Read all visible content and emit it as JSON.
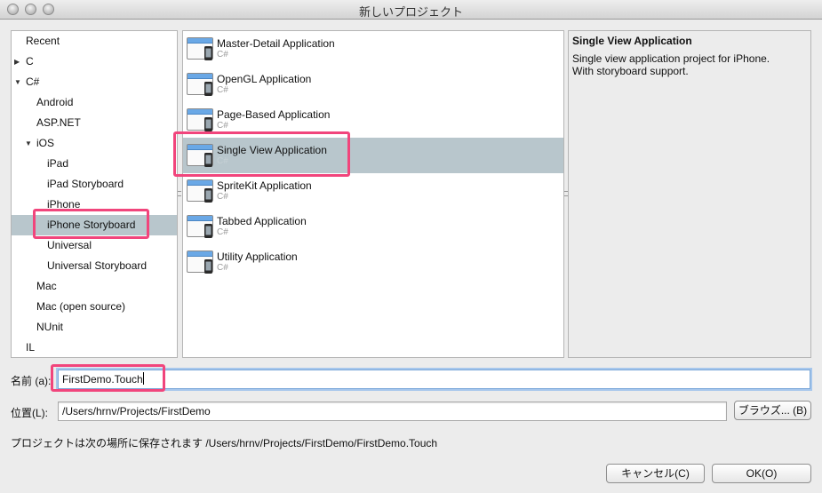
{
  "window": {
    "title": "新しいプロジェクト"
  },
  "categories": [
    {
      "label": "Recent",
      "indent": 0,
      "toggle": "none",
      "selected": false
    },
    {
      "label": "C",
      "indent": 0,
      "toggle": "collapsed",
      "selected": false
    },
    {
      "label": "C#",
      "indent": 0,
      "toggle": "expanded",
      "selected": false
    },
    {
      "label": "Android",
      "indent": 1,
      "toggle": "none",
      "selected": false
    },
    {
      "label": "ASP.NET",
      "indent": 1,
      "toggle": "none",
      "selected": false
    },
    {
      "label": "iOS",
      "indent": 1,
      "toggle": "expanded",
      "selected": false
    },
    {
      "label": "iPad",
      "indent": 2,
      "toggle": "none",
      "selected": false
    },
    {
      "label": "iPad Storyboard",
      "indent": 2,
      "toggle": "none",
      "selected": false
    },
    {
      "label": "iPhone",
      "indent": 2,
      "toggle": "none",
      "selected": false
    },
    {
      "label": "iPhone Storyboard",
      "indent": 2,
      "toggle": "none",
      "selected": true
    },
    {
      "label": "Universal",
      "indent": 2,
      "toggle": "none",
      "selected": false
    },
    {
      "label": "Universal Storyboard",
      "indent": 2,
      "toggle": "none",
      "selected": false
    },
    {
      "label": "Mac",
      "indent": 1,
      "toggle": "none",
      "selected": false
    },
    {
      "label": "Mac (open source)",
      "indent": 1,
      "toggle": "none",
      "selected": false
    },
    {
      "label": "NUnit",
      "indent": 1,
      "toggle": "none",
      "selected": false
    },
    {
      "label": "IL",
      "indent": 0,
      "toggle": "none",
      "selected": false
    }
  ],
  "templates": [
    {
      "name": "Master-Detail Application",
      "language": "C#",
      "selected": false
    },
    {
      "name": "OpenGL Application",
      "language": "C#",
      "selected": false
    },
    {
      "name": "Page-Based Application",
      "language": "C#",
      "selected": false
    },
    {
      "name": "Single View Application",
      "language": "C#",
      "selected": true
    },
    {
      "name": "SpriteKit Application",
      "language": "C#",
      "selected": false
    },
    {
      "name": "Tabbed Application",
      "language": "C#",
      "selected": false
    },
    {
      "name": "Utility Application",
      "language": "C#",
      "selected": false
    }
  ],
  "description": {
    "title": "Single View Application",
    "body": "Single view application project for iPhone.\nWith storyboard support."
  },
  "form": {
    "name_label": "名前 (a):",
    "name_value": "FirstDemo.Touch",
    "location_label": "位置(L):",
    "location_value": "/Users/hrnv/Projects/FirstDemo",
    "browse_label": "ブラウズ... (B)",
    "save_info": "プロジェクトは次の場所に保存されます /Users/hrnv/Projects/FirstDemo/FirstDemo.Touch"
  },
  "buttons": {
    "cancel": "キャンセル(C)",
    "ok": "OK(O)"
  },
  "colors": {
    "selection": "#b8c6cc",
    "highlight": "#f1457c",
    "focus_ring": "#a7c7ec"
  },
  "icons": {
    "collapsed": "disclosure-right-icon",
    "expanded": "disclosure-down-icon",
    "template": "app-window-icon"
  }
}
